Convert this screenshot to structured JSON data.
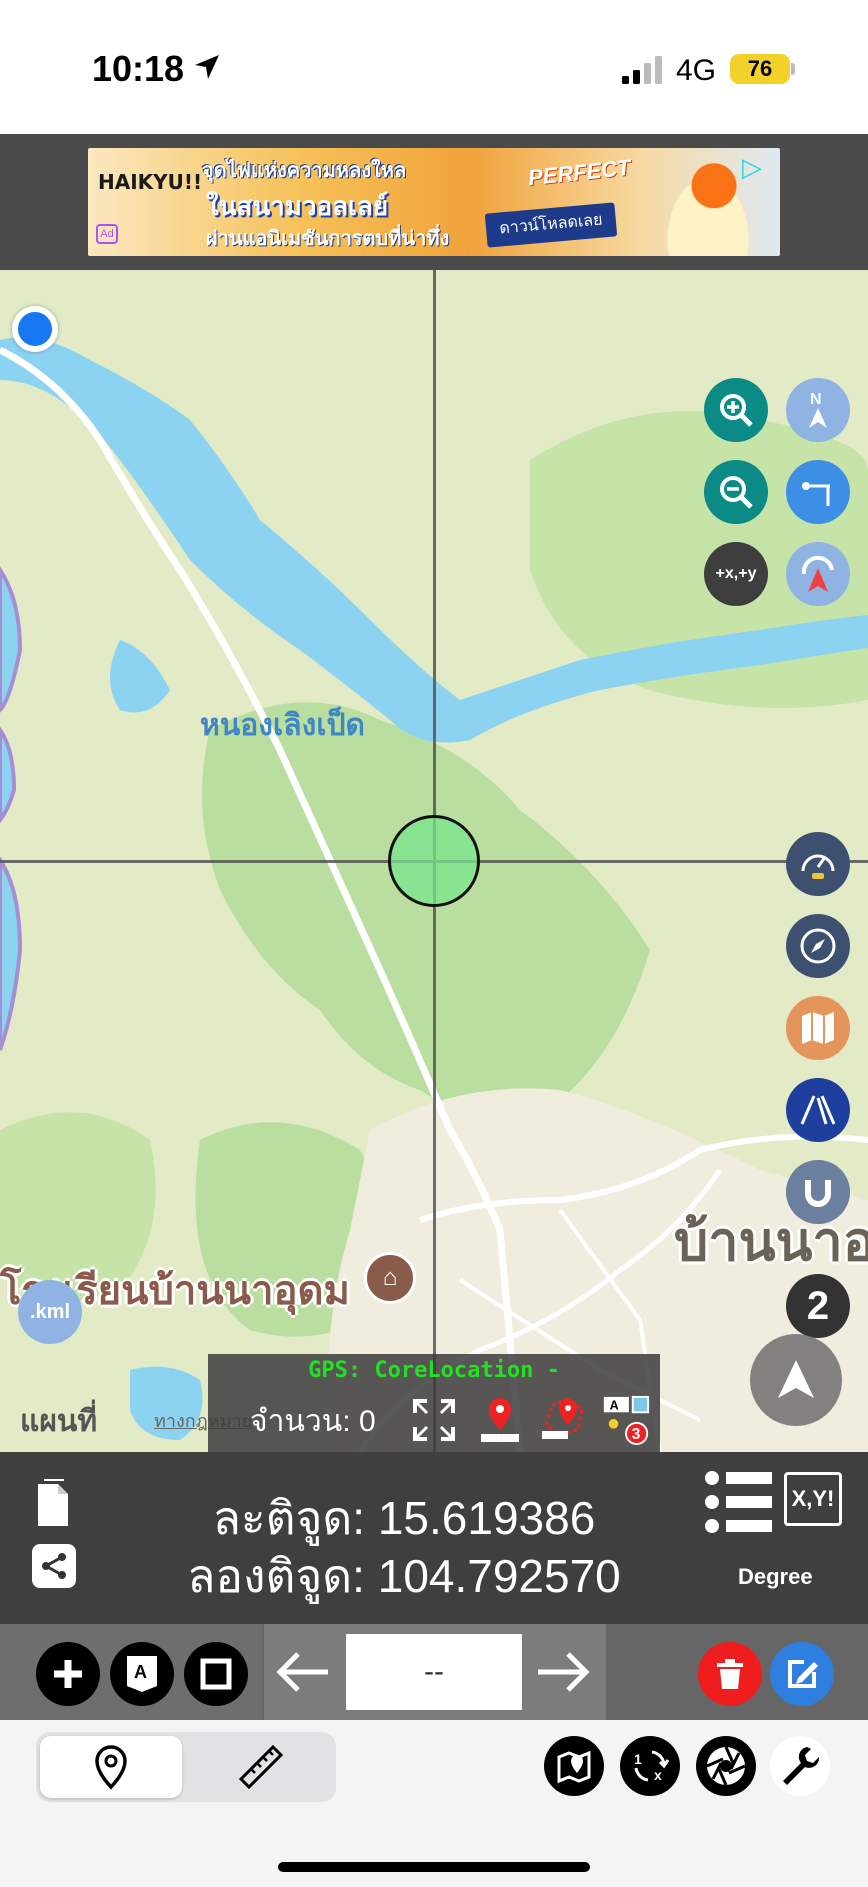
{
  "status_bar": {
    "time": "10:18",
    "network": "4G",
    "battery": "76"
  },
  "ad": {
    "logo": "HAIKYU!!",
    "badge": "Ad",
    "line1": "จุดไฟแห่งความหลงใหล",
    "line2": "ในสนามวอลเลย์",
    "line3": "ผ่านแอนิเมชันการตบที่น่าทึ่ง",
    "download": "ดาวน์โหลดเลย",
    "perfect": "PERFECT"
  },
  "map": {
    "pond_label": "หนองเลิงเป็ด",
    "village_label": "บ้านนาอ",
    "school_label": "โรงเรียนบ้านนาอุดม",
    "maps_attribution": "แผนที่",
    "legal_link": "ทางกฎหมาย",
    "kml_button": ".kml",
    "offset_button": "+x,+y",
    "page_badge": "2",
    "colors": {
      "land": "#e2ebc6",
      "water": "#8cd3f2",
      "forest": "#b9dea0",
      "urban": "#f0ecde"
    }
  },
  "gps_panel": {
    "status": "GPS: CoreLocation -",
    "count": "จำนวน: 0",
    "badge_letter": "A",
    "badge_count": "3"
  },
  "coords": {
    "latitude": "ละติจูด: 15.619386",
    "longitude": "ลองติจูด: 104.792570",
    "xy_label": "X,Y!",
    "unit": "Degree"
  },
  "toolbar": {
    "page_value": "--",
    "text_button": "A"
  },
  "bottom_bar": {
    "selected_tab": "pin",
    "icons": [
      "map-pin-icon",
      "ruler-icon",
      "map-marker-icon",
      "swap-icon",
      "camera-shutter-icon",
      "wrench-icon"
    ]
  }
}
